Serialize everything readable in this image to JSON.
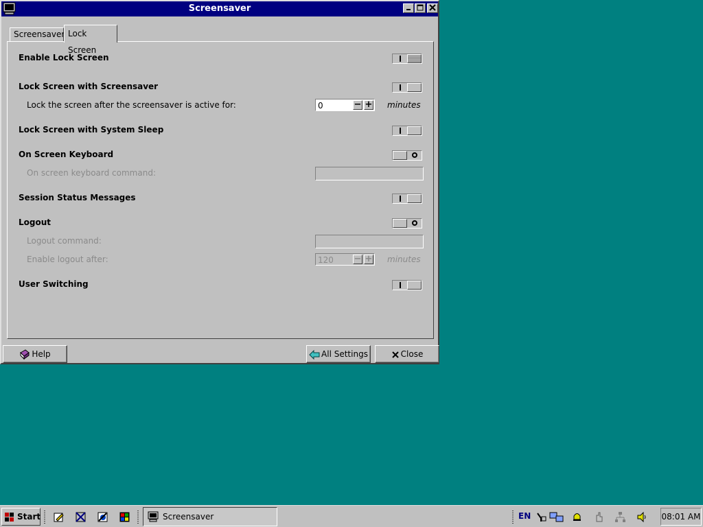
{
  "window": {
    "title": "Screensaver"
  },
  "tabs": [
    {
      "label": "Screensaver",
      "active": false
    },
    {
      "label": "Lock Screen",
      "active": true
    }
  ],
  "settings": {
    "enable_lock_screen": {
      "label": "Enable Lock Screen",
      "state": "on"
    },
    "lock_with_screensaver": {
      "label": "Lock Screen with Screensaver",
      "state": "on",
      "sub_label": "Lock the screen after the screensaver is active for:",
      "value": "0",
      "units": "minutes"
    },
    "lock_with_sleep": {
      "label": "Lock Screen with System Sleep",
      "state": "on"
    },
    "on_screen_keyboard": {
      "label": "On Screen Keyboard",
      "state": "off",
      "sub_label": "On screen keyboard command:",
      "command": ""
    },
    "session_status": {
      "label": "Session Status Messages",
      "state": "on"
    },
    "logout": {
      "label": "Logout",
      "state": "off",
      "command_label": "Logout command:",
      "command": "",
      "after_label": "Enable logout after:",
      "after_value": "120",
      "units": "minutes"
    },
    "user_switching": {
      "label": "User Switching",
      "state": "on"
    }
  },
  "buttons": {
    "help": "Help",
    "all_settings": "All Settings",
    "close": "Close"
  },
  "taskbar": {
    "start": "Start",
    "task": "Screensaver",
    "language": "EN",
    "clock": "08:01 AM"
  },
  "colors": {
    "desktop": "#008080",
    "titlebar": "#000080",
    "face": "#c0c0c0"
  }
}
